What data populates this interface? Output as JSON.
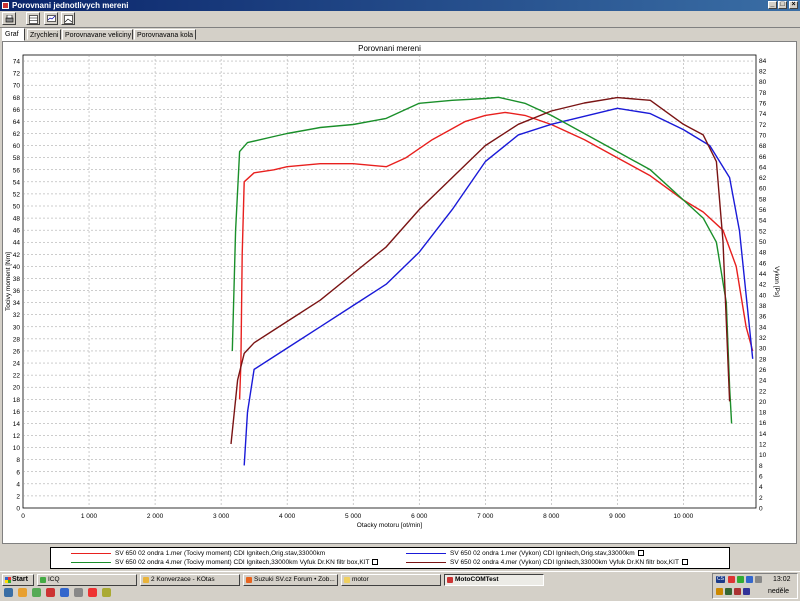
{
  "window": {
    "title": "Porovnani jednotlivych mereni"
  },
  "toolbar": {
    "icons": [
      "print-icon",
      "table-icon",
      "graph-icon",
      "image-icon"
    ]
  },
  "tabs": [
    "Graf",
    "Zrychleni",
    "Porovnavane veliciny",
    "Porovnavana kola"
  ],
  "active_tab": 0,
  "legend": [
    {
      "label": "SV 650 02 ondra 1.mer  (Tocivy moment)  CDI Ignitech,Orig.stav,33000km",
      "color": "#e8201e"
    },
    {
      "label": "SV 650 02 ondra 1.mer  (Vykon)  CDI Ignitech,Orig.stav,33000km",
      "color": "#1a1ad8"
    },
    {
      "label": "SV 650 02 ondra 4.mer  (Tocivy moment)  CDI Ignitech,33000km  Vyfuk Dr.KN filtr box,KIT",
      "color": "#1a8f2a"
    },
    {
      "label": "SV 650 02 ondra 4.mer  (Vykon)  CDI Ignitech,33000km  Vyfuk Dr.KN filtr box,KIT",
      "color": "#7a1414"
    }
  ],
  "chart_data": {
    "type": "line",
    "title": "Porovnani mereni",
    "xlabel": "Otacky motoru [ot/min]",
    "ylabel": "Tocivy moment [Nm]",
    "y2label": "Vykon [Ps]",
    "xlim": [
      0,
      11100
    ],
    "ylim": [
      0,
      75
    ],
    "y2lim": [
      0,
      85
    ],
    "x_ticks": [
      0,
      1000,
      2000,
      3000,
      4000,
      5000,
      6000,
      7000,
      8000,
      9000,
      10000
    ],
    "x_tick_labels": [
      "0",
      "1 000",
      "2 000",
      "3 000",
      "4 000",
      "5 000",
      "6 000",
      "7 000",
      "8 000",
      "9 000",
      "10 000"
    ],
    "y_ticks_step": 2,
    "y_ticks_max": 74,
    "y2_ticks_step": 2,
    "y2_ticks_max": 84,
    "grid": true,
    "series": [
      {
        "name": "SV 650 02 ondra 1.mer (Tocivy moment)",
        "color": "#e8201e",
        "axis": "left",
        "points": [
          [
            3280,
            18
          ],
          [
            3300,
            24
          ],
          [
            3320,
            42
          ],
          [
            3350,
            54
          ],
          [
            3500,
            55.5
          ],
          [
            3800,
            56
          ],
          [
            4000,
            56.5
          ],
          [
            4500,
            57
          ],
          [
            5000,
            57
          ],
          [
            5500,
            56.5
          ],
          [
            5800,
            58
          ],
          [
            6200,
            61
          ],
          [
            6700,
            64
          ],
          [
            7000,
            65
          ],
          [
            7300,
            65.5
          ],
          [
            7600,
            65
          ],
          [
            8000,
            63.5
          ],
          [
            8500,
            61
          ],
          [
            9000,
            58
          ],
          [
            9500,
            55
          ],
          [
            10000,
            51
          ],
          [
            10300,
            49
          ],
          [
            10600,
            46
          ],
          [
            10800,
            40
          ],
          [
            10950,
            30
          ],
          [
            11050,
            26
          ]
        ]
      },
      {
        "name": "SV 650 02 ondra 1.mer (Vykon)",
        "color": "#1a1ad8",
        "axis": "right",
        "points": [
          [
            3350,
            8
          ],
          [
            3400,
            18
          ],
          [
            3500,
            26
          ],
          [
            4000,
            30
          ],
          [
            4500,
            34
          ],
          [
            5000,
            38
          ],
          [
            5500,
            42
          ],
          [
            6000,
            48
          ],
          [
            6500,
            56
          ],
          [
            7000,
            65
          ],
          [
            7500,
            70
          ],
          [
            8000,
            72
          ],
          [
            8500,
            73.5
          ],
          [
            9000,
            75
          ],
          [
            9500,
            74
          ],
          [
            10000,
            71
          ],
          [
            10400,
            68
          ],
          [
            10700,
            62
          ],
          [
            10850,
            52
          ],
          [
            10950,
            40
          ],
          [
            11050,
            28
          ]
        ]
      },
      {
        "name": "SV 650 02 ondra 4.mer (Tocivy moment)",
        "color": "#1a8f2a",
        "axis": "left",
        "points": [
          [
            3170,
            26
          ],
          [
            3220,
            46
          ],
          [
            3280,
            59
          ],
          [
            3400,
            60.5
          ],
          [
            3800,
            61.5
          ],
          [
            4000,
            62
          ],
          [
            4500,
            63
          ],
          [
            5000,
            63.5
          ],
          [
            5500,
            64.5
          ],
          [
            6000,
            67
          ],
          [
            6500,
            67.5
          ],
          [
            7000,
            67.8
          ],
          [
            7200,
            68
          ],
          [
            7600,
            67
          ],
          [
            8000,
            65
          ],
          [
            8500,
            62
          ],
          [
            9000,
            59
          ],
          [
            9500,
            56
          ],
          [
            10000,
            51
          ],
          [
            10300,
            48
          ],
          [
            10500,
            44
          ],
          [
            10650,
            34
          ],
          [
            10700,
            20
          ],
          [
            10730,
            14
          ]
        ]
      },
      {
        "name": "SV 650 02 ondra 4.mer (Vykon)",
        "color": "#7a1414",
        "axis": "right",
        "points": [
          [
            3150,
            12
          ],
          [
            3250,
            24
          ],
          [
            3350,
            29
          ],
          [
            3500,
            31
          ],
          [
            4000,
            35
          ],
          [
            4500,
            39
          ],
          [
            5000,
            44
          ],
          [
            5500,
            49
          ],
          [
            6000,
            56
          ],
          [
            6500,
            62
          ],
          [
            7000,
            68
          ],
          [
            7500,
            72
          ],
          [
            8000,
            74.5
          ],
          [
            8500,
            76
          ],
          [
            9000,
            77
          ],
          [
            9500,
            76.5
          ],
          [
            10000,
            72
          ],
          [
            10300,
            70
          ],
          [
            10500,
            65
          ],
          [
            10600,
            50
          ],
          [
            10650,
            35
          ],
          [
            10700,
            20
          ]
        ]
      }
    ]
  },
  "taskbar": {
    "start": "Start",
    "items": [
      "ICQ",
      "2 Konverzace - KOtas",
      "Suzuki SV.cz Forum • Zob...",
      "motor",
      "MotoCOMTest"
    ],
    "active_item": 4,
    "lang": "CS",
    "time": "13:02",
    "day": "neděle"
  }
}
